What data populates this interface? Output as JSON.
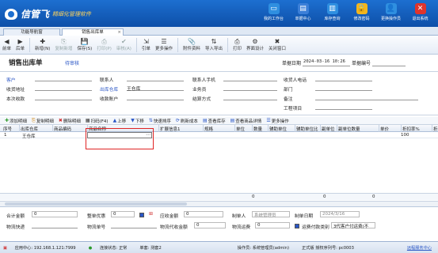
{
  "app": {
    "brand": "信管飞",
    "slogan": "精细化管理软件"
  },
  "topnav": [
    {
      "label": "我的工作台",
      "icon": "monitor-icon",
      "color": "#2f8fe0"
    },
    {
      "label": "单据中心",
      "icon": "document-icon",
      "color": "#3b7fd8"
    },
    {
      "label": "库存查询",
      "icon": "warehouse-icon",
      "color": "#2f8fe0"
    },
    {
      "label": "修改密码",
      "icon": "lock-icon",
      "color": "#f2b51d"
    },
    {
      "label": "更换操作员",
      "icon": "user-icon",
      "color": "#2f8fe0"
    },
    {
      "label": "退出系统",
      "icon": "close-icon",
      "color": "#e0342c"
    }
  ],
  "tabs": [
    {
      "label": "功能导航窗"
    },
    {
      "label": "销售出库单",
      "close": "×"
    }
  ],
  "toolbar": [
    {
      "label": "前单",
      "icon": "◀",
      "dis": false
    },
    {
      "label": "后单",
      "icon": "▶",
      "dis": false
    },
    {
      "label": "新增(N)",
      "icon": "✚",
      "dis": false
    },
    {
      "label": "复制新增",
      "icon": "⎘",
      "dis": true
    },
    {
      "label": "保存(S)",
      "icon": "💾",
      "dis": false
    },
    {
      "label": "打印(P)",
      "icon": "⎙",
      "dis": true
    },
    {
      "label": "审核(A)",
      "icon": "✔",
      "dis": true
    },
    {
      "label": "引单",
      "icon": "⇲",
      "dis": false
    },
    {
      "label": "更多操作",
      "icon": "☰",
      "dis": false
    },
    {
      "label": "附件资料",
      "icon": "📎",
      "dis": false
    },
    {
      "label": "导入导出",
      "icon": "⇅",
      "dis": false
    },
    {
      "label": "打印",
      "icon": "⎙",
      "dis": false
    },
    {
      "label": "界面设计",
      "icon": "⚙",
      "dis": false
    },
    {
      "label": "关闭窗口",
      "icon": "✖",
      "dis": false
    }
  ],
  "doc": {
    "title": "销售出库单",
    "status": "待审核",
    "date_label": "单据日期",
    "date_value": "2024-03-16 10:26",
    "no_label": "单据编号"
  },
  "header": {
    "customer": "客户",
    "contact": "联系人",
    "contact_phone": "联系人手机",
    "receiver_phone": "收货人电话",
    "address": "收货地址",
    "out_warehouse": "出库仓库",
    "warehouse_value": "王仓库",
    "business_unit": "业务员",
    "department": "部门",
    "last_receipt": "本次收款",
    "receipt_account": "收款账户",
    "settle": "结算方式",
    "remark": "备注",
    "project": "工程项目"
  },
  "detail_tools": [
    {
      "label": "添加明细",
      "icon": "✚",
      "color": "#2c9a2c"
    },
    {
      "label": "复制明细",
      "icon": "⎘",
      "color": "#d08a1b"
    },
    {
      "label": "删除明细",
      "icon": "✖",
      "color": "#d02b2b"
    },
    {
      "label": "扫码(F4)",
      "icon": "▦",
      "color": "#333"
    },
    {
      "label": "上移",
      "icon": "▲",
      "color": "#2a56c6"
    },
    {
      "label": "下移",
      "icon": "▼",
      "color": "#2a56c6"
    },
    {
      "label": "快速排序",
      "icon": "⇅",
      "color": "#2a56c6"
    },
    {
      "label": "刷新成本",
      "icon": "⟳",
      "color": "#2a56c6"
    },
    {
      "label": "查看库存",
      "icon": "▤",
      "color": "#2a56c6"
    },
    {
      "label": "查看商品详情",
      "icon": "▤",
      "color": "#2a56c6"
    },
    {
      "label": "更多操作",
      "icon": "☰",
      "color": "#2a56c6"
    }
  ],
  "grid": {
    "columns": [
      "序号",
      "出库仓库",
      "商品编码",
      "商品名称",
      "扩展信息1",
      "规格",
      "单位",
      "数量",
      "辅助单位",
      "辅助单位比",
      "副单位",
      "副单位数量",
      "单价",
      "折扣率%",
      "折"
    ],
    "row": {
      "no": "1",
      "warehouse": "王仓库",
      "discount": "100"
    },
    "totals": {
      "qty": "0",
      "aux": "0",
      "amount": "0"
    }
  },
  "footer": {
    "total_amount": "合计金额",
    "total_amount_v": "0",
    "whole_discount": "整单优惠",
    "whole_discount_v": "0",
    "amount_due": "应收金额",
    "amount_due_v": "0",
    "maker": "制单人",
    "maker_v": "系统管理员",
    "make_date": "制单日期",
    "make_date_v": "2024/3/16",
    "logistics_express": "物流快递",
    "logistics_no": "物流单号",
    "logistics_cod": "物流代收金额",
    "logistics_cod_v": "0",
    "logistics_fee": "物流运费",
    "logistics_fee_v": "0",
    "fee_pay": "运费付款类别",
    "fee_pay_v": "3代客户付运费(不"
  },
  "status": {
    "server": "应用中心: 192.168.1.121:7999",
    "conn": "连接状态: 正常",
    "type": "单套: 测套2",
    "operator": "操作员: 系统管理员(admin)",
    "edition": "正式版 授权序列号: pc0003",
    "help": "远程服务中心"
  }
}
